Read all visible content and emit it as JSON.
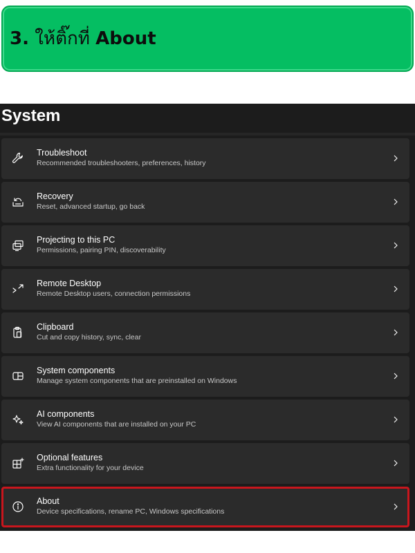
{
  "banner": {
    "step_number": "3.",
    "instruction": "ให้ติ๊กที่",
    "target": "About"
  },
  "page_title": "System",
  "settings": [
    {
      "icon": "wrench-icon",
      "title": "Troubleshoot",
      "subtitle": "Recommended troubleshooters, preferences, history"
    },
    {
      "icon": "recovery-icon",
      "title": "Recovery",
      "subtitle": "Reset, advanced startup, go back"
    },
    {
      "icon": "projector-icon",
      "title": "Projecting to this PC",
      "subtitle": "Permissions, pairing PIN, discoverability"
    },
    {
      "icon": "remote-desktop-icon",
      "title": "Remote Desktop",
      "subtitle": "Remote Desktop users, connection permissions"
    },
    {
      "icon": "clipboard-icon",
      "title": "Clipboard",
      "subtitle": "Cut and copy history, sync, clear"
    },
    {
      "icon": "system-components-icon",
      "title": "System components",
      "subtitle": "Manage system components that are preinstalled on Windows"
    },
    {
      "icon": "sparkle-icon",
      "title": "AI components",
      "subtitle": "View AI components that are installed on your PC"
    },
    {
      "icon": "add-apps-icon",
      "title": "Optional features",
      "subtitle": "Extra functionality for your device"
    },
    {
      "icon": "info-icon",
      "title": "About",
      "subtitle": "Device specifications, rename PC, Windows specifications",
      "highlighted": true
    }
  ],
  "colors": {
    "banner_bg": "#05be62",
    "panel_bg": "#1c1c1c",
    "row_bg": "#2b2b2b",
    "highlight_border": "#c8161d"
  }
}
